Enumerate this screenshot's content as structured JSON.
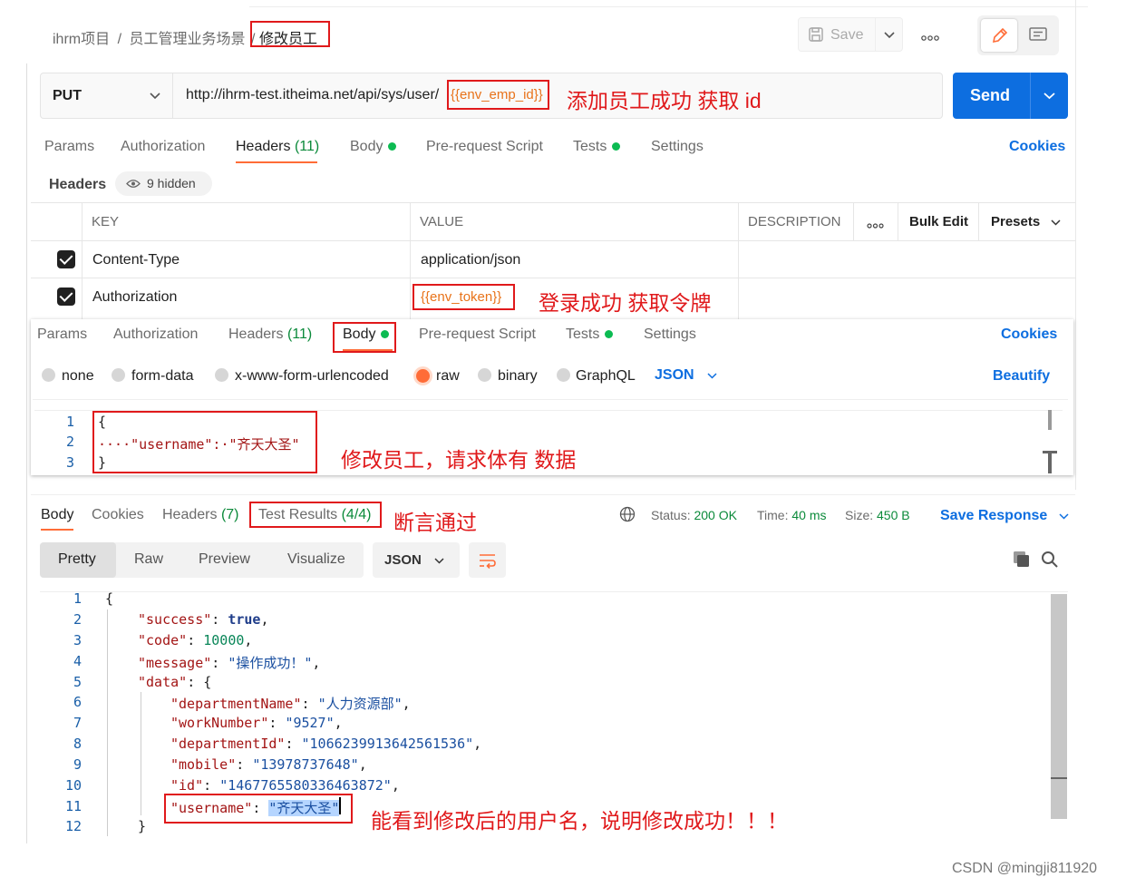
{
  "breadcrumb": {
    "project": "ihrm项目",
    "sep1": "/",
    "folder": "员工管理业务场景",
    "sep2": "/",
    "request": "修改员工"
  },
  "header": {
    "save_label": "Save"
  },
  "request": {
    "method": "PUT",
    "url_prefix": "http://ihrm-test.itheima.net/api/sys/user/",
    "url_var": "{{env_emp_id}}",
    "send_label": "Send"
  },
  "annotations": {
    "url": "添加员工成功 获取 id",
    "token": "登录成功 获取令牌",
    "body": "修改员工，请求体有 数据",
    "tests": "断言通过",
    "result": "能看到修改后的用户名，说明修改成功！！！"
  },
  "req_tabs": {
    "params": "Params",
    "authorization": "Authorization",
    "headers": "Headers",
    "headers_count": "(11)",
    "body": "Body",
    "prerequest": "Pre-request Script",
    "tests": "Tests",
    "settings": "Settings",
    "cookies": "Cookies"
  },
  "headers_panel": {
    "title": "Headers",
    "hidden": "9 hidden",
    "col_key": "KEY",
    "col_value": "VALUE",
    "col_desc": "DESCRIPTION",
    "more": "ooo",
    "bulk_edit": "Bulk Edit",
    "presets": "Presets",
    "rows": [
      {
        "key": "Content-Type",
        "value": "application/json"
      },
      {
        "key": "Authorization",
        "value": "{{env_token}}"
      }
    ]
  },
  "body_panel": {
    "modes": [
      "none",
      "form-data",
      "x-www-form-urlencoded",
      "raw",
      "binary",
      "GraphQL"
    ],
    "format": "JSON",
    "beautify": "Beautify",
    "lines": [
      "{",
      "····\"username\":·\"齐天大圣\"",
      "}"
    ]
  },
  "response": {
    "tabs": {
      "body": "Body",
      "cookies": "Cookies",
      "headers": "Headers",
      "headers_count": "(7)",
      "tests": "Test Results",
      "tests_count": "(4/4)"
    },
    "status_label": "Status:",
    "status_value": "200 OK",
    "time_label": "Time:",
    "time_value": "40 ms",
    "size_label": "Size:",
    "size_value": "450 B",
    "save_response": "Save Response",
    "views": [
      "Pretty",
      "Raw",
      "Preview",
      "Visualize"
    ],
    "format": "JSON",
    "json": {
      "success": "true",
      "code": "10000",
      "message": "\"操作成功！\"",
      "departmentName": "\"人力资源部\"",
      "workNumber": "\"9527\"",
      "departmentId": "\"1066239913642561536\"",
      "mobile": "\"13978737648\"",
      "id": "\"1467765580336463872\"",
      "username": "\"齐天大圣\""
    }
  },
  "watermark": "CSDN @mingji811920"
}
